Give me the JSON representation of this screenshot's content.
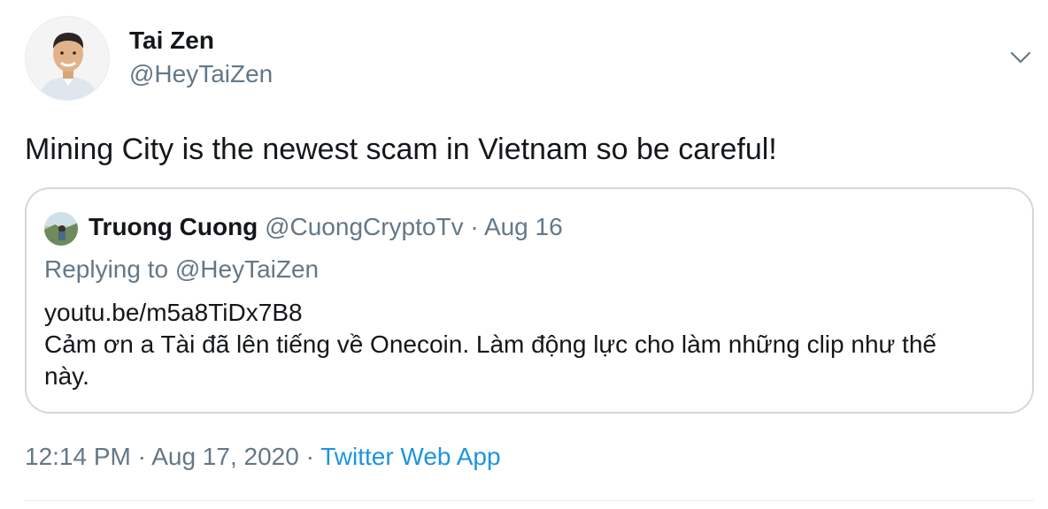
{
  "author": {
    "name": "Tai Zen",
    "handle": "@HeyTaiZen",
    "avatar": "profile-photo"
  },
  "menu_icon": "chevron-down-icon",
  "tweet": {
    "text": "Mining City is the newest scam in Vietnam so be careful!"
  },
  "quote": {
    "name": "Truong Cuong",
    "handle": "@CuongCryptoTv",
    "separator": "·",
    "date": "Aug 16",
    "replying_to": "Replying to @HeyTaiZen",
    "lines": [
      "youtu.be/m5a8TiDx7B8",
      "Cảm ơn a Tài đã lên tiếng về Onecoin. Làm động lực cho làm những clip như thế",
      "này."
    ]
  },
  "meta": {
    "time": "12:14 PM",
    "sep1": " · ",
    "date": "Aug 17, 2020",
    "sep2": " · ",
    "source": "Twitter Web App"
  },
  "colors": {
    "text": "#14171a",
    "secondary": "#657786",
    "link": "#1b95e0",
    "border": "#cfd9de"
  }
}
